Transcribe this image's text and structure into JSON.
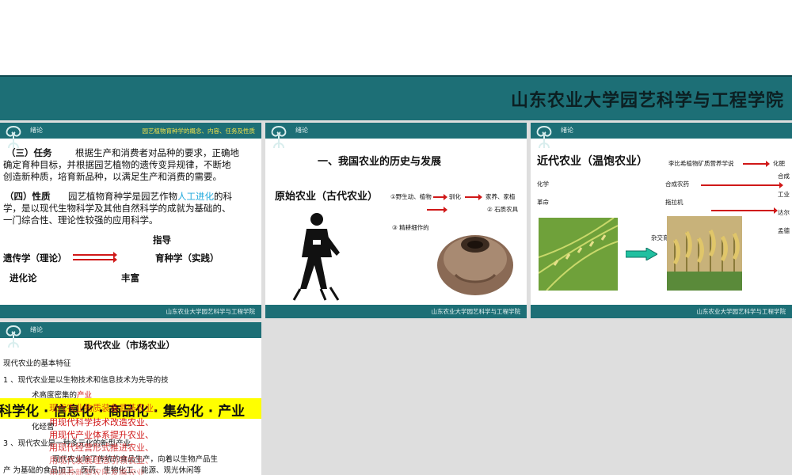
{
  "banner": {
    "title": "山东农业大学园艺科学与工程学院"
  },
  "slide1": {
    "tag": "绪论",
    "header_subtitle": "园艺植物育种学的概念、内容、任务及性质",
    "task_heading": "（三）任务",
    "task_line1": "根据生产和消费者对品种的要求，正确地",
    "task_line2": "确定育种目标，并根据园艺植物的遗传变异规律，不断地",
    "task_line3": "创造新种质，培育新品种，以满足生产和消费的需要。",
    "nature_heading": "（四）性质",
    "nature_line1_a": "园艺植物育种学是园艺作物",
    "nature_line1_b": "人工进化",
    "nature_line1_c": "的科",
    "nature_line2": "学，是以现代生物科学及其他自然科学的成就为基础的、",
    "nature_line3": "一门综合性、理论性较强的应用科学。",
    "guide": "指导",
    "genetics": "遗传学（理论）",
    "breeding": "育种学（实践）",
    "evolution": "进化论",
    "enrich": "丰富",
    "footer": "山东农业大学园艺科学与工程学院"
  },
  "slide2": {
    "tag": "绪论",
    "title": "一、我国农业的历史与发展",
    "primitive": "原始农业（古代农业）",
    "p1": "①野生动、植物",
    "p2": "驯化",
    "p3": "家养、家植",
    "p4": "② 石质农具",
    "p5": "③ 精耕细作的",
    "footer": "山东农业大学园艺科学与工程学院"
  },
  "slide3": {
    "tag": "绪论",
    "title": "近代农业（温饱农业）",
    "liebig": "李比希植物矿质营养学说",
    "fert": "化肥",
    "synth": "合成",
    "chem": "化学",
    "pesticide": "合成农药",
    "industry": "工业",
    "revolution": "革命",
    "tractor": "拖拉机",
    "darwin": "达尔",
    "mendel": "孟德",
    "hybrid": "杂交育",
    "footer": "山东农业大学园艺科学与工程学院"
  },
  "slide4": {
    "tag": "绪论",
    "title": "现代农业（市场农业）",
    "features": "现代农业的基本特征",
    "f1_a": "1 、现代农业是以生物技术和信息技术为先导的技",
    "f1_b": "术高度密集的",
    "f1_c": "产业",
    "banner_text": "科学化 · 信息化 · 商品化 · 集约化 · 产业",
    "overlay1": "现代农业物质装备武装农业、",
    "overlay2": "用现代科学技术改造农业、",
    "overlay3": "用现代产业体系提升农业、",
    "overlay4": "用现代经营形式推进农业、",
    "overlay5": "用现代发展理念引领农业、",
    "overlay6": "用培养新型农民发展农业",
    "f2": "化经营",
    "f3": "3 、现代农业是一种多元化的新型产业",
    "f3_b": "现代农业除了传统的食品生产，向着以生物产品生",
    "f3_c": "产    为基础的食品加工、医药、生物化工、能源、观光休闲等"
  }
}
